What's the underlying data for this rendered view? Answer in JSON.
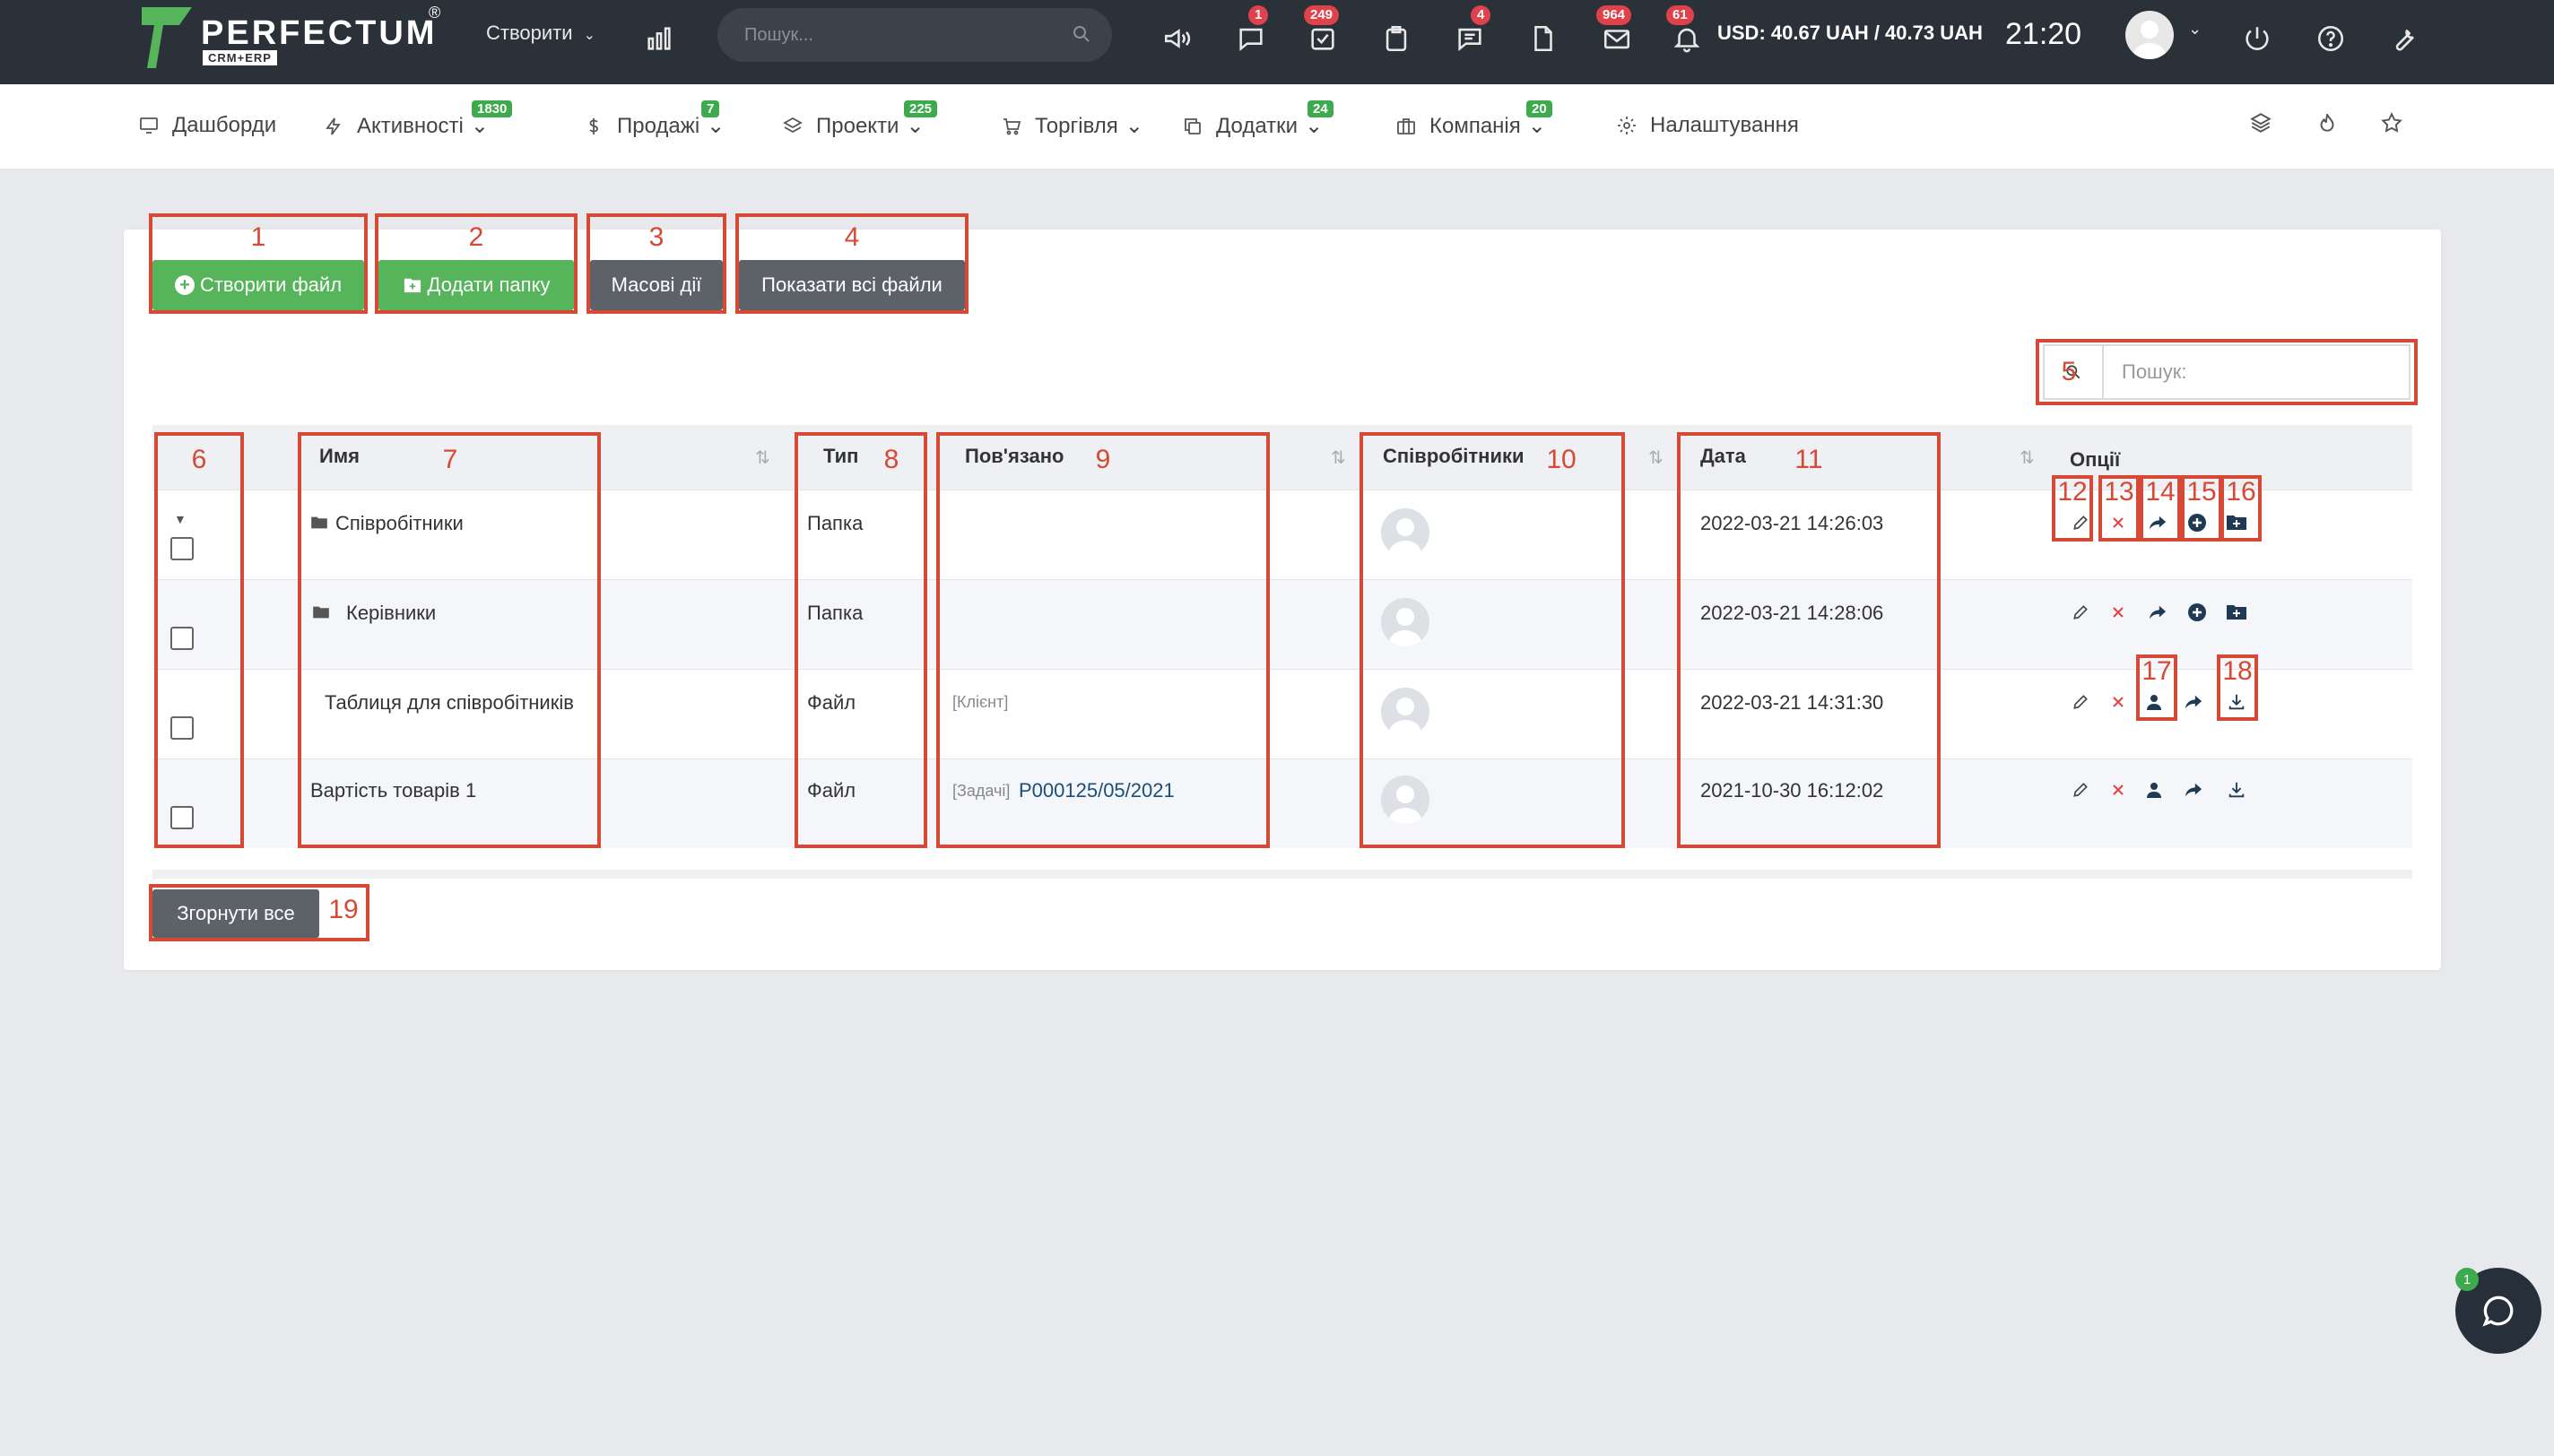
{
  "topbar": {
    "logo_text": "PERFECTUM",
    "logo_sub": "CRM+ERP",
    "logo_reg": "®",
    "create_label": "Створити",
    "search_placeholder": "Пошук...",
    "badges": {
      "chat": "1",
      "tasks": "249",
      "messages": "4",
      "mail": "964",
      "notifications": "61"
    },
    "currency": "USD: 40.67 UAH / 40.73 UAH",
    "time": "21:20"
  },
  "nav": {
    "items": [
      {
        "label": "Дашборди",
        "badge": "",
        "icon": "monitor-icon"
      },
      {
        "label": "Активності",
        "badge": "1830",
        "icon": "bolt-icon"
      },
      {
        "label": "Продажі",
        "badge": "7",
        "icon": "dollar-icon"
      },
      {
        "label": "Проекти",
        "badge": "225",
        "icon": "layers-icon"
      },
      {
        "label": "Торгівля",
        "badge": "",
        "icon": "cart-icon"
      },
      {
        "label": "Додатки",
        "badge": "24",
        "icon": "copy-icon"
      },
      {
        "label": "Компанія",
        "badge": "20",
        "icon": "briefcase-icon"
      },
      {
        "label": "Налаштування",
        "badge": "",
        "icon": "gear-icon"
      }
    ]
  },
  "toolbar": {
    "create_file": "Створити файл",
    "add_folder": "Додати папку",
    "bulk_actions": "Масові дії",
    "show_all": "Показати всі файли",
    "collapse_all": "Згорнути все"
  },
  "search": {
    "placeholder": "Пошук:"
  },
  "table": {
    "headers": {
      "name": "Имя",
      "type": "Тип",
      "related": "Пов'язано",
      "staff": "Співробітники",
      "date": "Дата",
      "options": "Опції"
    },
    "rows": [
      {
        "name": "Співробітники",
        "type": "Папка",
        "related_tag": "",
        "related_value": "",
        "date": "2022-03-21 14:26:03"
      },
      {
        "name": "Керівники",
        "type": "Папка",
        "related_tag": "",
        "related_value": "",
        "date": "2022-03-21 14:28:06"
      },
      {
        "name": "Таблиця для співробітників",
        "type": "Файл",
        "related_tag": "[Клієнт]",
        "related_value": "",
        "date": "2022-03-21 14:31:30"
      },
      {
        "name": "Вартість товарів 1",
        "type": "Файл",
        "related_tag": "[Задачі]",
        "related_value": "P000125/05/2021",
        "date": "2021-10-30 16:12:02"
      }
    ]
  },
  "annotations": [
    "1",
    "2",
    "3",
    "4",
    "5",
    "6",
    "7",
    "8",
    "9",
    "10",
    "11",
    "12",
    "13",
    "14",
    "15",
    "16",
    "17",
    "18",
    "19"
  ],
  "chat_badge": "1",
  "colors": {
    "topbar": "#2b3139",
    "green": "#56b45a",
    "gray_button": "#5d6168",
    "annotation": "#d64a35",
    "badge_red": "#e0424c",
    "badge_green": "#3daa4e"
  }
}
